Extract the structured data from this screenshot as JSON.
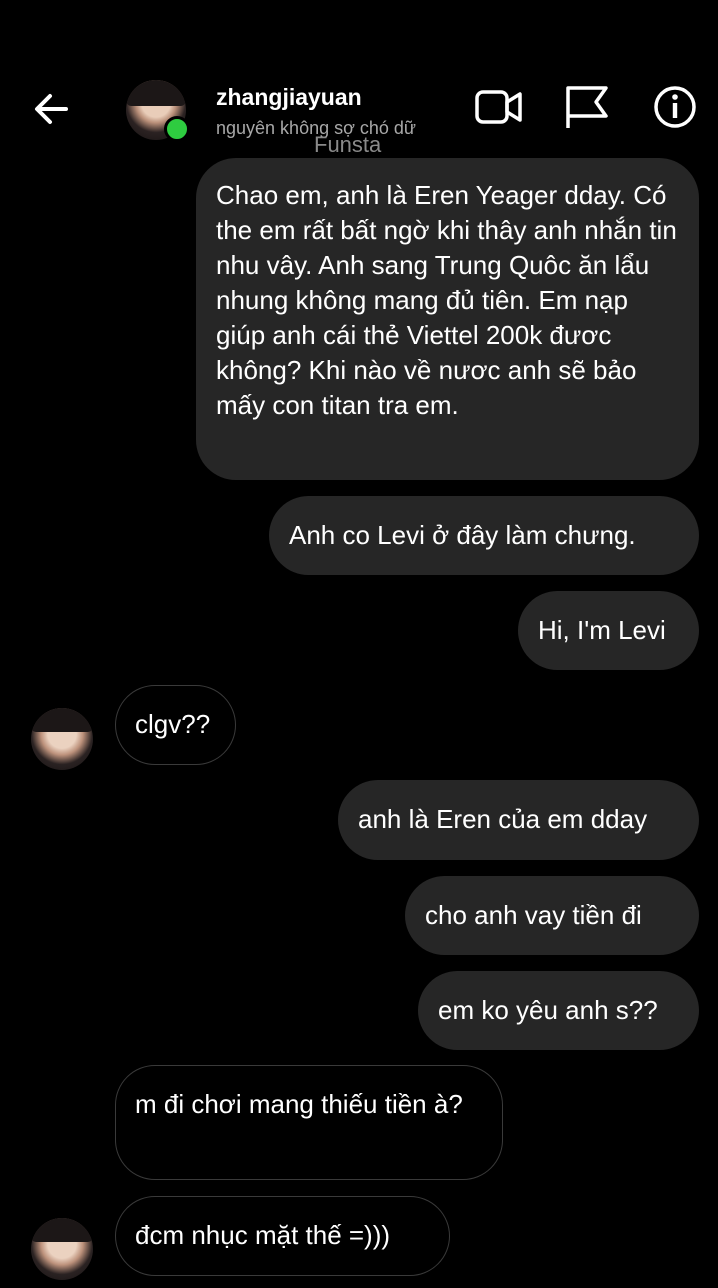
{
  "header": {
    "username": "zhangjiayuan",
    "subtitle": "nguyên không sợ chó dữ",
    "watermark": "Funsta",
    "icons": [
      "back-arrow-icon",
      "video-call-icon",
      "flag-icon",
      "info-icon"
    ],
    "online_color": "#2ecc40"
  },
  "messages": [
    {
      "side": "out",
      "text": "Chao em, anh là Eren Yeager dday. Có the em rất bất ngờ khi thây anh nhắn tin nhu vây. Anh sang Trung Quôc ăn lẩu nhung không mang đủ tiên. Em nạp giúp anh cái thẻ Viettel 200k đươc không? Khi nào về nươc anh sẽ bảo mấy con titan tra em."
    },
    {
      "side": "out",
      "text": "Anh co Levi ở đây làm chưng."
    },
    {
      "side": "out",
      "text": "Hi, I'm Levi"
    },
    {
      "side": "in",
      "text": "clgv??"
    },
    {
      "side": "out",
      "text": "anh là Eren của em dday"
    },
    {
      "side": "out",
      "text": "cho anh vay tiền đi"
    },
    {
      "side": "out",
      "text": "em ko yêu anh s??"
    },
    {
      "side": "in",
      "text": "m đi chơi mang thiếu tiền à?"
    },
    {
      "side": "in",
      "text": "đcm nhục mặt thế =)))"
    }
  ],
  "colors": {
    "background": "#000000",
    "outgoing_bubble": "#262626",
    "incoming_border": "#3a3a3a",
    "subtitle": "#a8a8a8"
  }
}
